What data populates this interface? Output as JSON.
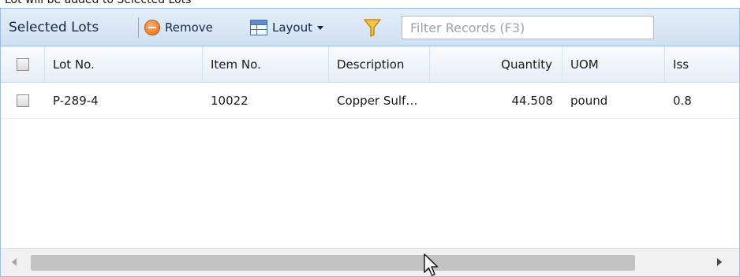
{
  "caption": "Lot will be added to Selected Lots",
  "toolbar": {
    "title": "Selected Lots",
    "remove_label": "Remove",
    "layout_label": "Layout",
    "filter_placeholder": "Filter Records (F3)"
  },
  "grid": {
    "columns": [
      "Lot No.",
      "Item No.",
      "Description",
      "Quantity",
      "UOM",
      "Iss"
    ],
    "rows": [
      {
        "lot_no": "P-289-4",
        "item_no": "10022",
        "description": "Copper Sulf…",
        "quantity": "44.508",
        "uom": "pound",
        "issued": "0.8"
      }
    ]
  },
  "colors": {
    "toolbar_bg": "#d6e4f4",
    "border": "#99bce8",
    "remove_icon": "#e6651a",
    "filter_icon": "#e09a1e"
  },
  "icons": {
    "remove": "remove-icon",
    "layout": "layout-grid-icon",
    "filter": "funnel-icon",
    "cursor": "mouse-pointer-icon"
  }
}
